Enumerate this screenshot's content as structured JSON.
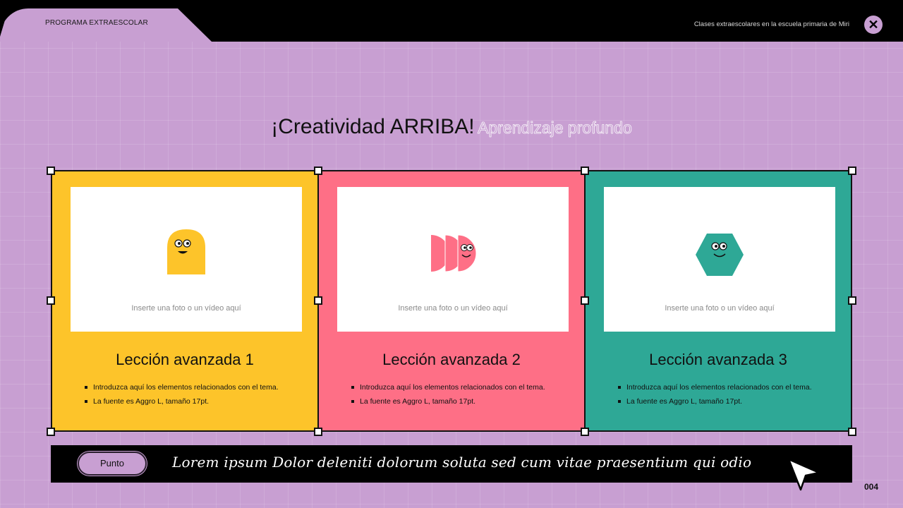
{
  "header": {
    "tab_label": "PROGRAMA EXTRAESCOLAR",
    "subtitle": "Clases extraescolares en la escuela primaria de Miri",
    "close_symbol": "✕"
  },
  "heading": {
    "main": "¡Creatividad ARRIBA!",
    "sub": "Aprendizaje profundo"
  },
  "cards": [
    {
      "media_label": "Inserte una foto o un vídeo aquí",
      "title": "Lección avanzada 1",
      "bullets": [
        "Introduzca aquí los elementos relacionados con el tema.",
        "La fuente es Aggro L, tamaño 17pt."
      ],
      "color": "#fdc42a",
      "mascot": "yellow-blob-mascot-icon"
    },
    {
      "media_label": "Inserte una foto o un vídeo aquí",
      "title": "Lección avanzada 2",
      "bullets": [
        "Introduzca aquí los elementos relacionados con el tema.",
        "La fuente es Aggro L, tamaño 17pt."
      ],
      "color": "#fe6f86",
      "mascot": "pink-semicircles-mascot-icon"
    },
    {
      "media_label": "Inserte una foto o un vídeo aquí",
      "title": "Lección avanzada 3",
      "bullets": [
        "Introduzca aquí los elementos relacionados con el tema.",
        "La fuente es Aggro L, tamaño 17pt."
      ],
      "color": "#2ea896",
      "mascot": "teal-hexagon-mascot-icon"
    }
  ],
  "footer": {
    "pill_label": "Punto",
    "text": "Lorem ipsum Dolor deleniti dolorum soluta sed cum vitae praesentium qui odio",
    "page_number": "004"
  },
  "colors": {
    "background": "#c89fd2",
    "bar": "#000000"
  }
}
